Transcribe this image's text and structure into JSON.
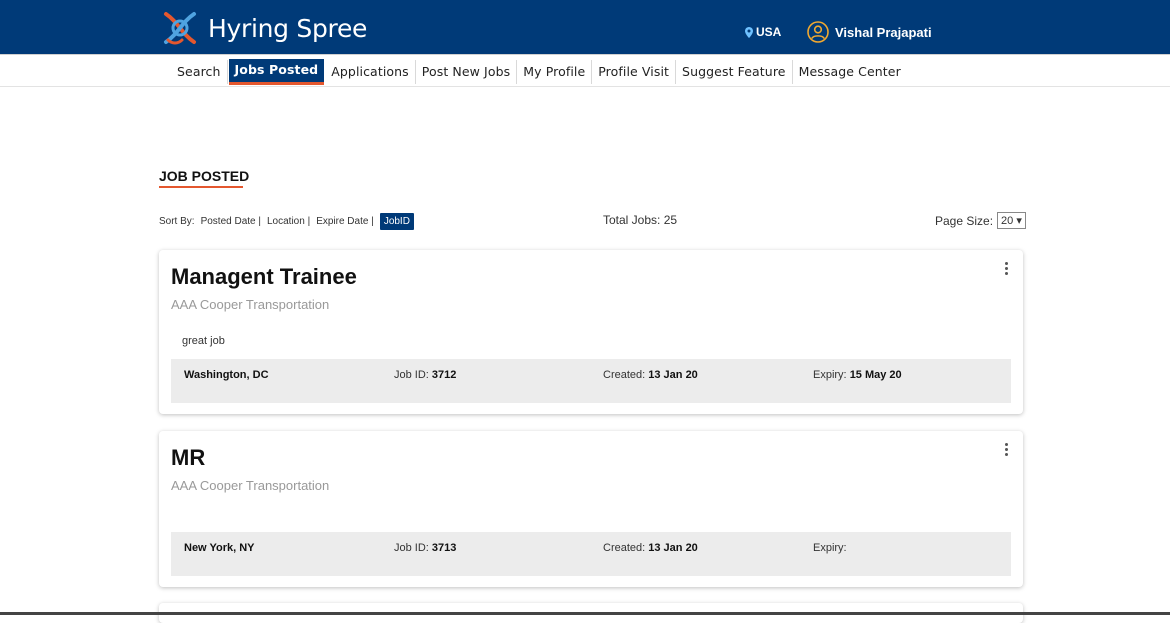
{
  "header": {
    "brand": "Hyring Spree",
    "location": "USA",
    "user_name": "Vishal Prajapati",
    "colors": {
      "header_bg": "#003a78",
      "accent": "#e4572e"
    },
    "icons": {
      "logo": "hyring-spree-logo-icon",
      "location": "location-pin-icon",
      "user": "user-circle-icon"
    }
  },
  "nav": {
    "items": [
      {
        "label": "Search"
      },
      {
        "label": "Jobs Posted",
        "active": true
      },
      {
        "label": "Applications"
      },
      {
        "label": "Post New Jobs"
      },
      {
        "label": "My Profile"
      },
      {
        "label": "Profile Visit"
      },
      {
        "label": "Suggest Feature"
      },
      {
        "label": "Message Center"
      }
    ]
  },
  "page": {
    "title": "JOB POSTED",
    "sort_label": "Sort By:",
    "sort_options": [
      "Posted Date |",
      "Location |",
      "Expire Date |",
      "JobID"
    ],
    "sort_selected": "JobID",
    "total_jobs": "Total Jobs: 25",
    "page_size_label": "Page Size:",
    "page_size_value": "20 ▾"
  },
  "jobs": [
    {
      "title": "Managent Trainee",
      "company": "AAA Cooper Transportation",
      "description": "great job",
      "location": "Washington, DC",
      "job_id_label": "Job ID:",
      "job_id": "3712",
      "created_label": "Created:",
      "created": "13 Jan 20",
      "expiry_label": "Expiry:",
      "expiry": "15 May 20"
    },
    {
      "title": "MR",
      "company": "AAA Cooper Transportation",
      "description": "",
      "location": "New York, NY",
      "job_id_label": "Job ID:",
      "job_id": "3713",
      "created_label": "Created:",
      "created": "13 Jan 20",
      "expiry_label": "Expiry:",
      "expiry": ""
    }
  ]
}
